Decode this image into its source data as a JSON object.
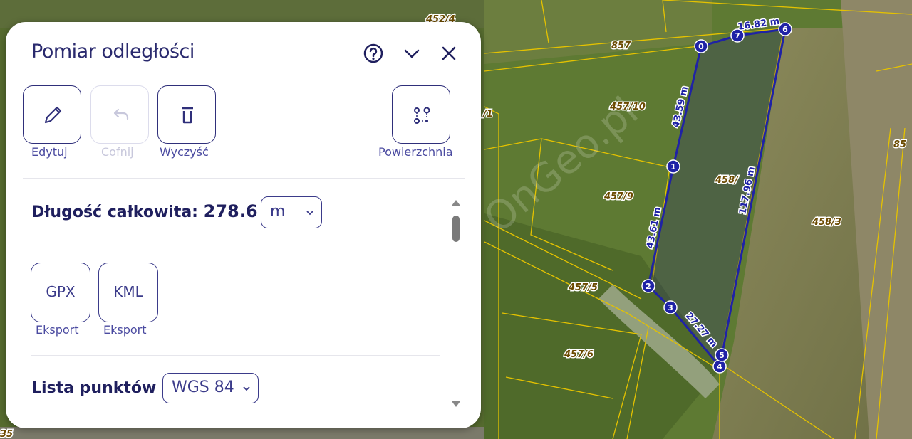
{
  "panel": {
    "title": "Pomiar odległości",
    "header_icons": [
      "help-icon",
      "chevron-down-icon",
      "close-icon"
    ],
    "tools": [
      {
        "label": "Edytuj",
        "icon": "pencil-icon",
        "enabled": true
      },
      {
        "label": "Cofnij",
        "icon": "undo-icon",
        "enabled": false
      },
      {
        "label": "Wyczyść",
        "icon": "trash-icon",
        "enabled": true
      },
      {
        "label": "Powierzchnia",
        "icon": "area-points-icon",
        "enabled": true
      }
    ],
    "length": {
      "label": "Długość całkowita:",
      "value": "278.6",
      "unit": "m"
    },
    "exports": [
      {
        "button": "GPX",
        "label": "Eksport"
      },
      {
        "button": "KML",
        "label": "Eksport"
      }
    ],
    "points_list": {
      "label": "Lista punktów",
      "crs": "WGS 84"
    }
  },
  "map": {
    "watermark": "OnGeo.pl",
    "parcels": [
      "452/4",
      "857",
      "457/10",
      "457/9",
      "457/5",
      "457/6",
      "458/",
      "458/3",
      "85",
      "/1",
      "35",
      "7",
      "0"
    ],
    "segments": [
      "16.82 m",
      "43.59 m",
      "117.96 m",
      "43.61 m",
      "27.27 m"
    ],
    "points": [
      "0",
      "1",
      "2",
      "3",
      "4",
      "5",
      "6",
      "7"
    ],
    "colors": {
      "line": "#1f22a6",
      "parcel_line": "#e5c200",
      "parcel_label": "#6b4a00",
      "accent": "#3b3b8a"
    }
  }
}
